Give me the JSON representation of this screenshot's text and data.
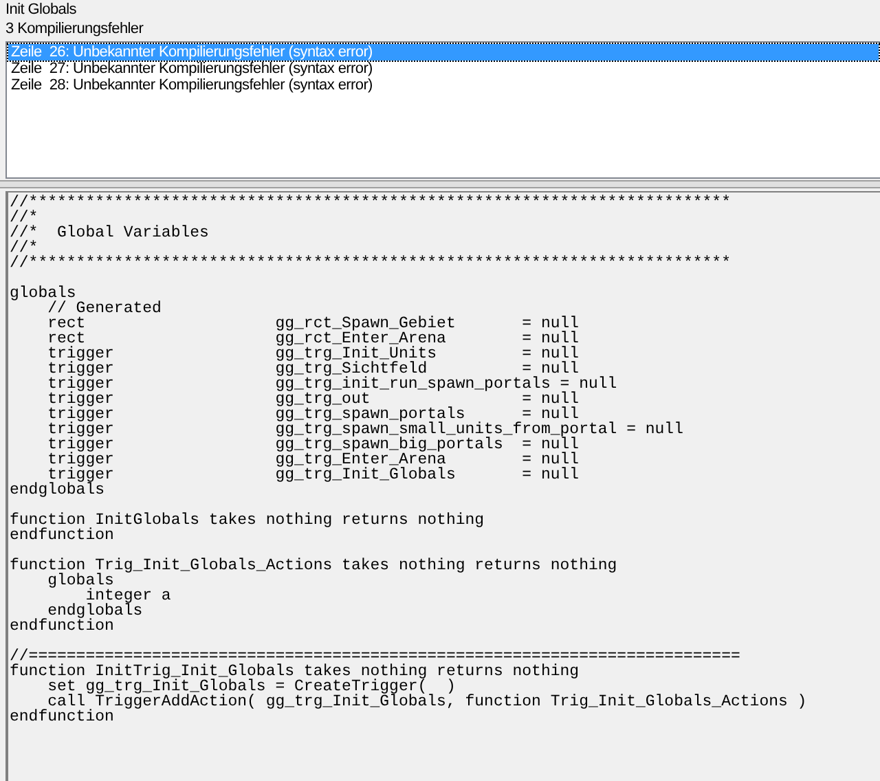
{
  "title": "Init Globals",
  "error_summary": "3 Kompilierungsfehler",
  "errors": [
    {
      "text": "Zeile  26: Unbekannter Kompilierungsfehler (syntax error)",
      "selected": true
    },
    {
      "text": "Zeile  27: Unbekannter Kompilierungsfehler (syntax error)",
      "selected": false
    },
    {
      "text": "Zeile  28: Unbekannter Kompilierungsfehler (syntax error)",
      "selected": false
    }
  ],
  "code_blocks": [
    [
      "//**************************************************************************",
      "//*",
      "//*  Global Variables",
      "//*",
      "//**************************************************************************"
    ],
    [
      "globals",
      "    // Generated",
      "    rect                    gg_rct_Spawn_Gebiet       = null",
      "    rect                    gg_rct_Enter_Arena        = null",
      "    trigger                 gg_trg_Init_Units         = null",
      "    trigger                 gg_trg_Sichtfeld          = null",
      "    trigger                 gg_trg_init_run_spawn_portals = null",
      "    trigger                 gg_trg_out                = null",
      "    trigger                 gg_trg_spawn_portals      = null",
      "    trigger                 gg_trg_spawn_small_units_from_portal = null",
      "    trigger                 gg_trg_spawn_big_portals  = null",
      "    trigger                 gg_trg_Enter_Arena        = null",
      "    trigger                 gg_trg_Init_Globals       = null",
      "endglobals"
    ],
    [
      "function InitGlobals takes nothing returns nothing",
      "endfunction"
    ],
    [
      "function Trig_Init_Globals_Actions takes nothing returns nothing",
      "    globals",
      "        integer a",
      "    endglobals",
      "endfunction"
    ],
    [
      "//===========================================================================",
      "function InitTrig_Init_Globals takes nothing returns nothing",
      "    set gg_trg_Init_Globals = CreateTrigger(  )",
      "    call TriggerAddAction( gg_trg_Init_Globals, function Trig_Init_Globals_Actions )",
      "endfunction"
    ]
  ]
}
